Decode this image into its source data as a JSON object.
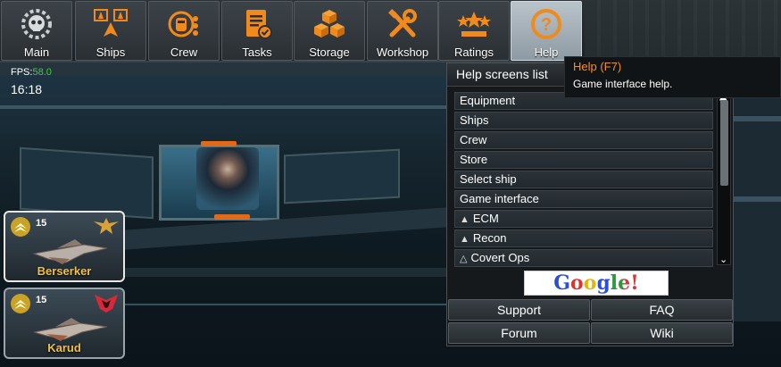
{
  "nav": {
    "tabs": [
      {
        "label": "Main",
        "icon": "skull-gear-icon"
      },
      {
        "label": "Ships",
        "icon": "ships-icon"
      },
      {
        "label": "Crew",
        "icon": "crew-icon"
      },
      {
        "label": "Tasks",
        "icon": "tasks-icon"
      },
      {
        "label": "Storage",
        "icon": "storage-crates-icon"
      },
      {
        "label": "Workshop",
        "icon": "workshop-tools-icon"
      },
      {
        "label": "Ratings",
        "icon": "ratings-stars-icon"
      },
      {
        "label": "Help",
        "icon": "help-question-icon"
      }
    ],
    "active_tab": "Help",
    "accent_color": "#f08a1c"
  },
  "hud": {
    "fps_label": "FPS:",
    "fps_value": "58.0",
    "clock": "16:18"
  },
  "ships": [
    {
      "name": "Berserker",
      "level": "15",
      "faction_icon": "eagle-emblem-icon",
      "name_color": "#f0c040"
    },
    {
      "name": "Karud",
      "level": "15",
      "faction_icon": "red-chevron-emblem-icon",
      "name_color": "#f0c040"
    }
  ],
  "help": {
    "title": "Help screens list",
    "items": [
      {
        "label": "Equipment",
        "icon": ""
      },
      {
        "label": "Ships",
        "icon": ""
      },
      {
        "label": "Crew",
        "icon": ""
      },
      {
        "label": "Store",
        "icon": ""
      },
      {
        "label": "Select ship",
        "icon": ""
      },
      {
        "label": "Game interface",
        "icon": ""
      },
      {
        "label": "ECM",
        "icon": "triangle-icon"
      },
      {
        "label": "Recon",
        "icon": "triangle-icon"
      },
      {
        "label": "Covert Ops",
        "icon": "triangle-outline-icon"
      }
    ],
    "google_label": "Google!",
    "buttons": {
      "support": "Support",
      "faq": "FAQ",
      "forum": "Forum",
      "wiki": "Wiki"
    }
  },
  "tooltip": {
    "title": "Help (F7)",
    "text": "Game interface help."
  }
}
